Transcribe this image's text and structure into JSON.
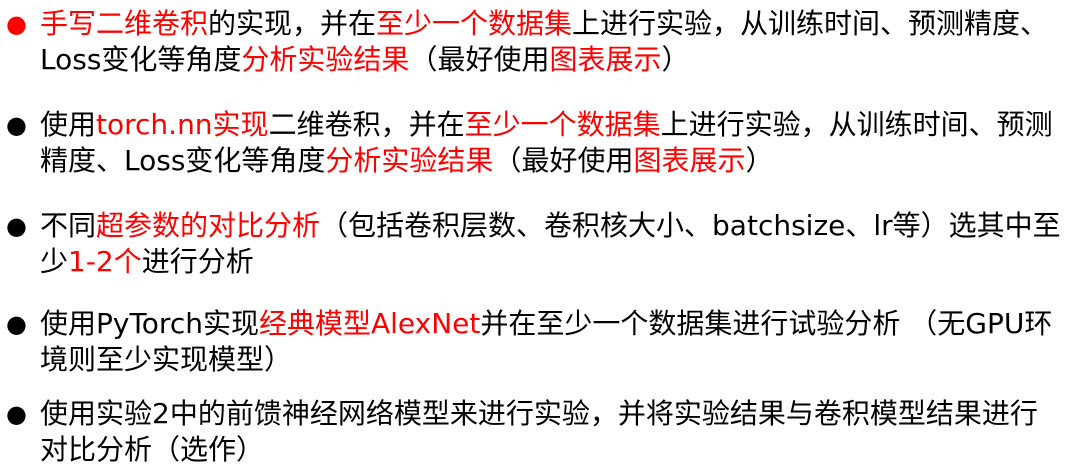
{
  "bullet_colors": [
    "#ff0000",
    "#000000",
    "#000000",
    "#000000",
    "#000000"
  ],
  "bullet_glyph": "●",
  "accent_color": "#ff0000",
  "items": [
    {
      "segments": [
        {
          "text": "手写二维卷积",
          "red": true
        },
        {
          "text": "的实现，并在",
          "red": false
        },
        {
          "text": "至少一个数据集",
          "red": true
        },
        {
          "text": "上进行实验，从训练时间、预测精度、Loss变化等角度",
          "red": false
        },
        {
          "text": "分析实验结果",
          "red": true
        },
        {
          "text": "（最好使用",
          "red": false
        },
        {
          "text": "图表展示",
          "red": true
        },
        {
          "text": "）",
          "red": false
        }
      ]
    },
    {
      "segments": [
        {
          "text": "使用",
          "red": false
        },
        {
          "text": "torch.nn实现",
          "red": true
        },
        {
          "text": "二维卷积，并在",
          "red": false
        },
        {
          "text": "至少一个数据集",
          "red": true
        },
        {
          "text": "上进行实验，从训练时间、预测精度、Loss变化等角度",
          "red": false
        },
        {
          "text": "分析实验结果",
          "red": true
        },
        {
          "text": "（最好使用",
          "red": false
        },
        {
          "text": "图表展示",
          "red": true
        },
        {
          "text": "）",
          "red": false
        }
      ]
    },
    {
      "segments": [
        {
          "text": "不同",
          "red": false
        },
        {
          "text": "超参数的对比分析",
          "red": true
        },
        {
          "text": "（包括卷积层数、卷积核大小、batchsize、lr等）选其中至少",
          "red": false
        },
        {
          "text": "1-2个",
          "red": true
        },
        {
          "text": "进行分析",
          "red": false
        }
      ]
    },
    {
      "segments": [
        {
          "text": "使用PyTorch实现",
          "red": false
        },
        {
          "text": "经典模型AlexNet",
          "red": true
        },
        {
          "text": "并在至少一个数据集进行试验分析 （无GPU环境则至少实现模型）",
          "red": false
        }
      ]
    },
    {
      "segments": [
        {
          "text": "使用实验2中的前馈神经网络模型来进行实验，并将实验结果与卷积模型结果进行对比分析（选作）",
          "red": false
        }
      ]
    }
  ]
}
